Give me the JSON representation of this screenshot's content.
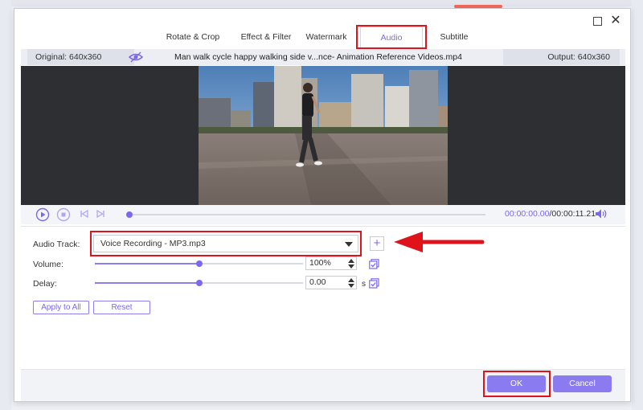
{
  "colors": {
    "accent": "#7b68ee",
    "highlight": "#e0131b",
    "button": "#8a7cf0",
    "video_bg": "#2e2f33"
  },
  "tabs": [
    {
      "label": "Rotate & Crop",
      "active": false
    },
    {
      "label": "Effect & Filter",
      "active": false
    },
    {
      "label": "Watermark",
      "active": false
    },
    {
      "label": "Audio",
      "active": true
    },
    {
      "label": "Subtitle",
      "active": false
    }
  ],
  "infobar": {
    "original": "Original: 640x360",
    "filename": "Man walk cycle happy walking side v...nce- Animation Reference Videos.mp4",
    "output": "Output: 640x360",
    "preview_icon": "eye-icon"
  },
  "player": {
    "current_time": "00:00:00.00",
    "total_time": "/00:00:11.21",
    "progress": 0.0,
    "icons": [
      "play-icon",
      "stop-icon",
      "previous-frame-icon",
      "next-frame-icon",
      "volume-icon"
    ]
  },
  "audio": {
    "track_label": "Audio Track:",
    "track_value": "Voice Recording - MP3.mp3",
    "add_track_icon": "plus-icon",
    "volume_label": "Volume:",
    "volume_value": "100%",
    "volume_level": 0.5,
    "delay_label": "Delay:",
    "delay_value": "0.00",
    "delay_unit": "s",
    "delay_level": 0.5,
    "apply_to_all": "Apply to All",
    "reset": "Reset"
  },
  "footer": {
    "ok": "OK",
    "cancel": "Cancel"
  }
}
